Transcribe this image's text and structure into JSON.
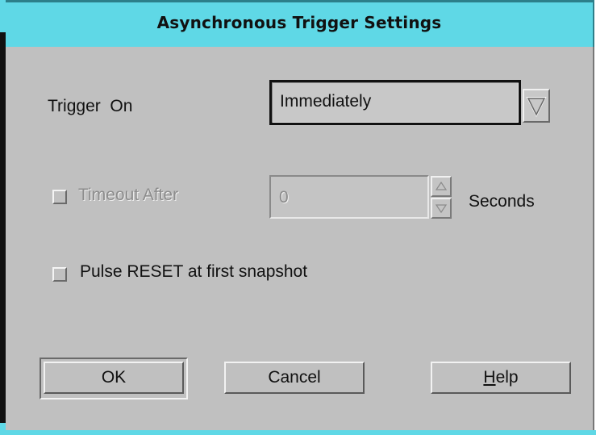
{
  "window": {
    "title": "Asynchronous Trigger Settings"
  },
  "trigger_on": {
    "label": "Trigger  On",
    "selected": "Immediately"
  },
  "timeout": {
    "label": "Timeout After",
    "value": "0",
    "unit": "Seconds",
    "checked": false,
    "enabled": false
  },
  "pulse_reset": {
    "label": "Pulse RESET at first snapshot",
    "checked": false
  },
  "buttons": {
    "ok": "OK",
    "cancel": "Cancel",
    "help_mnemonic": "H",
    "help_rest": "elp"
  }
}
